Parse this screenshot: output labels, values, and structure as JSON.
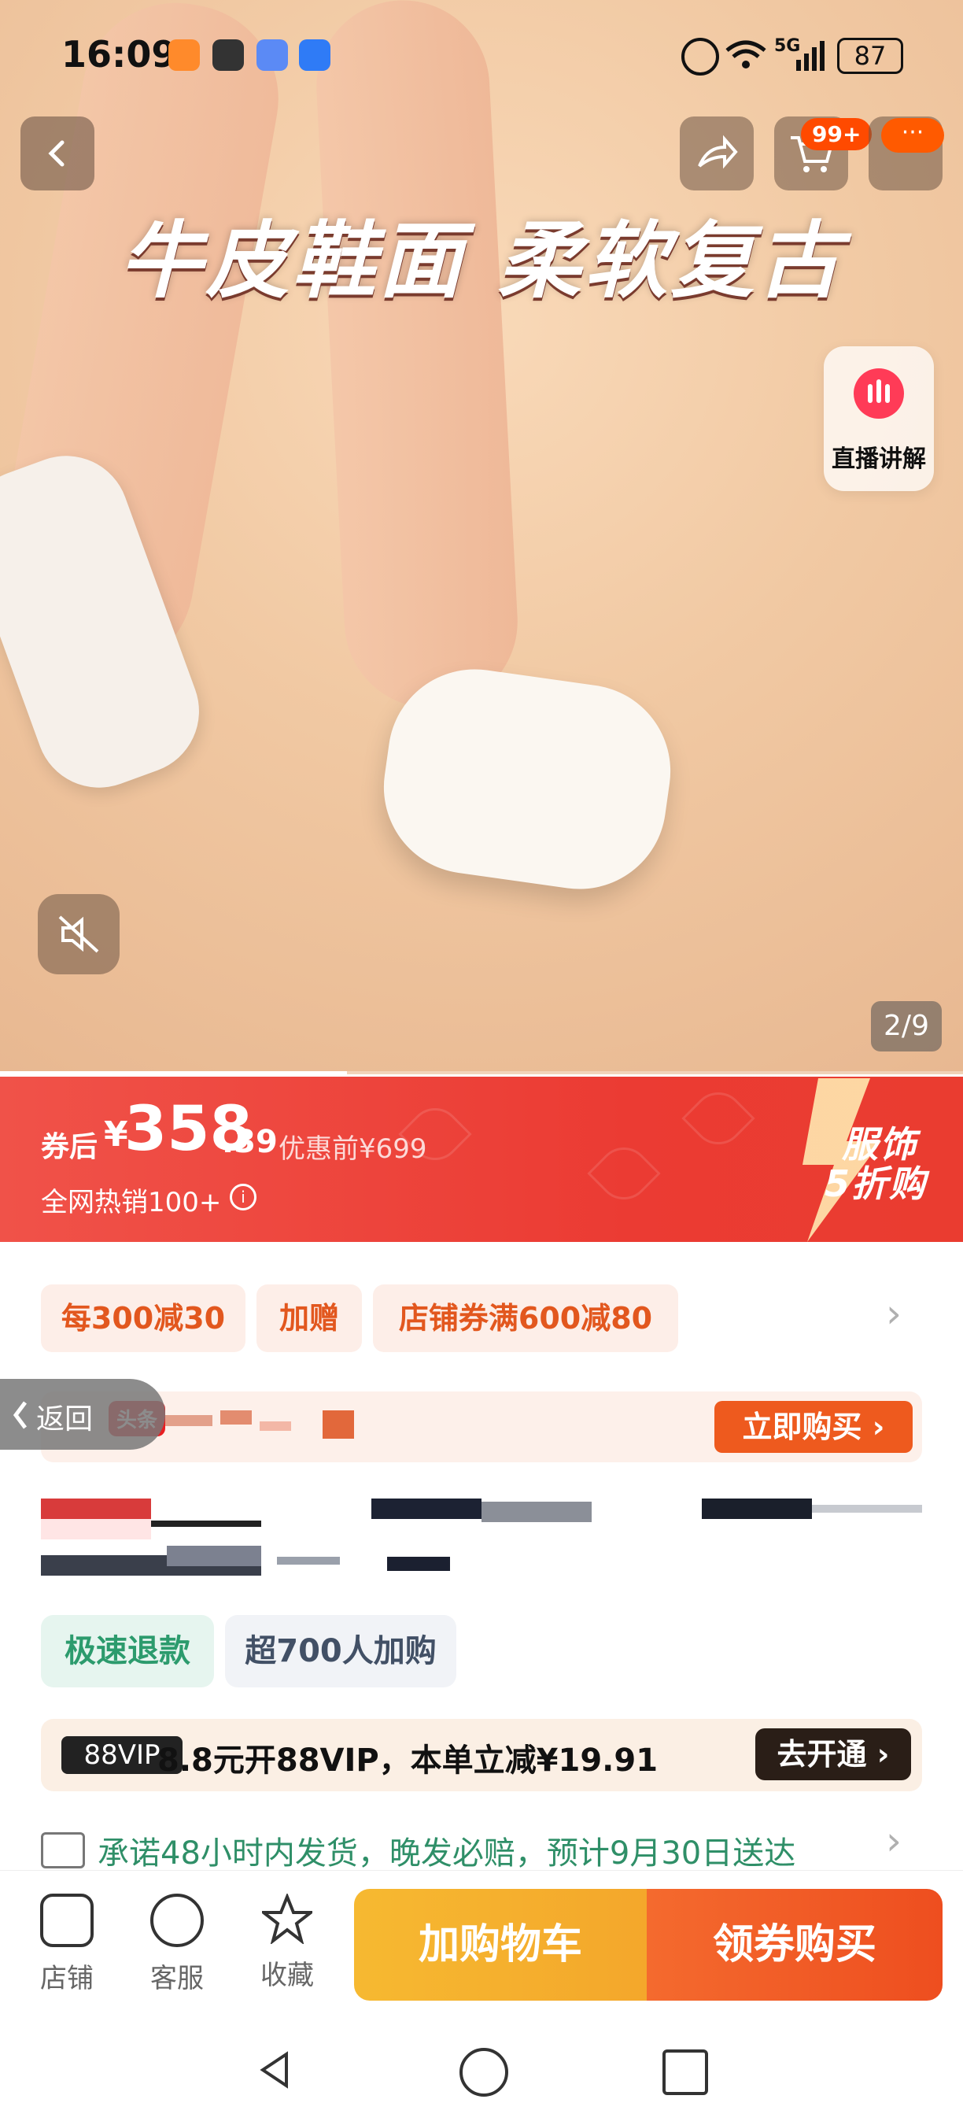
{
  "status_bar": {
    "time": "16:09",
    "network": "5G",
    "battery": "87",
    "icons": [
      "shield-app-icon",
      "hand-icon",
      "game-controller-icon",
      "blue-sphere-icon",
      "alarm-icon",
      "wifi-icon",
      "signal-icon",
      "battery-icon"
    ]
  },
  "hero": {
    "headline": "牛皮鞋面 柔软复古",
    "cart_badge": "99+",
    "more_dots": "···",
    "live_label": "直播讲解",
    "image_counter": "2/9",
    "progress_fraction": 0.36
  },
  "price": {
    "after_label": "券后",
    "yen": "¥",
    "main": "358",
    "cents": ".39",
    "original": "优惠前¥699",
    "sales": "全网热销100+",
    "promo_line1": "服饰",
    "promo_line2": "5折购"
  },
  "tags": {
    "t1": "每300减30",
    "t2": "加赠",
    "t3": "店铺券满600减80"
  },
  "live_row": {
    "return_label": "返回",
    "toutiao": "头条",
    "buy_now": "立即购买"
  },
  "features": {
    "refund": "极速退款",
    "buyers": "超700人加购"
  },
  "vip": {
    "badge": "88VIP",
    "text": "8.8元开88VIP，本单立减¥19.91",
    "button": "去开通 ›"
  },
  "shipping": {
    "text": "承诺48小时内发货，晚发必赔，预计9月30日送达"
  },
  "bottom_nav": {
    "store": "店铺",
    "service": "客服",
    "fav": "收藏",
    "add_cart": "加购物车",
    "coupon_buy": "领券购买"
  },
  "colors": {
    "price_red": "#eb3b33",
    "orange": "#ee5a1e",
    "yellow_btn": "#f6b931",
    "green": "#2c9b6d"
  }
}
